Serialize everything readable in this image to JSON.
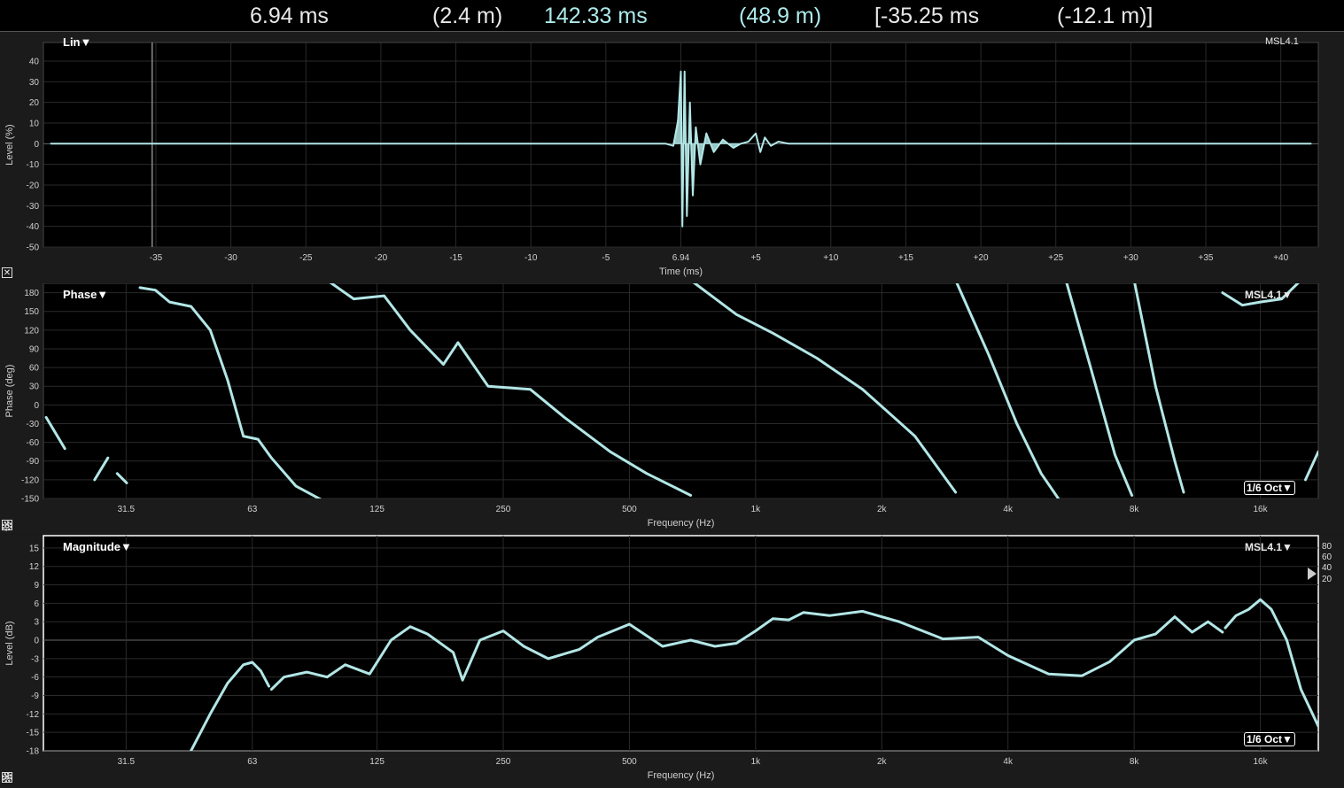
{
  "readout": {
    "delay_time": "6.94 ms",
    "delay_dist": "(2.4 m)",
    "abs_time": "142.33 ms",
    "abs_dist": "(48.9 m)",
    "cursor_time": "[-35.25 ms",
    "cursor_dist": "(-12.1 m)]"
  },
  "colors": {
    "trace": "#b3e6e6",
    "plot_bg": "#000000",
    "grid": "#2a2a2a",
    "accent_text": "#aeeaea",
    "text": "#ffffff"
  },
  "icons": {
    "close": "close-icon",
    "gear": "gear-icon"
  },
  "impulse": {
    "mode_label": "Lin▼",
    "device_label": "MSL4.1",
    "ylabel": "Level (%)",
    "xlabel": "Time (ms)",
    "chart_data": {
      "type": "line",
      "title": "",
      "xlabel": "Time (ms)",
      "ylabel": "Level (%)",
      "x_ticks": [
        "-35",
        "-30",
        "-25",
        "-20",
        "-15",
        "-10",
        "-5",
        "6.94",
        "+5",
        "+10",
        "+15",
        "+20",
        "+25",
        "+30",
        "+35",
        "+40"
      ],
      "x_tick_values": [
        -35,
        -30,
        -25,
        -20,
        -15,
        -10,
        -5,
        0,
        5,
        10,
        15,
        20,
        25,
        30,
        35,
        40
      ],
      "xlim": [
        -42.5,
        42.5
      ],
      "y_ticks": [
        "40",
        "30",
        "20",
        "10",
        "0",
        "-10",
        "-20",
        "-30",
        "-40",
        "-50"
      ],
      "y_tick_values": [
        40,
        30,
        20,
        10,
        0,
        -10,
        -20,
        -30,
        -40,
        -50
      ],
      "ylim": [
        -50,
        49
      ],
      "grid": true,
      "cursor_x": -35.25,
      "series": [
        {
          "values_x": [
            -42,
            -30,
            -10,
            -1,
            -0.5,
            -0.2,
            0,
            0.1,
            0.25,
            0.4,
            0.6,
            0.8,
            1.0,
            1.3,
            1.7,
            2.2,
            2.8,
            3.5,
            4.0,
            4.5,
            5.0,
            5.3,
            5.6,
            6.0,
            6.5,
            7.2,
            8,
            12,
            20,
            30,
            42
          ],
          "values_y": [
            0,
            0,
            0,
            0,
            -1,
            10,
            35,
            -40,
            35,
            -35,
            20,
            -25,
            8,
            -10,
            5,
            -4,
            2,
            -2,
            0,
            1,
            5,
            -4,
            3,
            -1,
            1,
            0,
            0,
            0,
            0,
            0,
            0
          ]
        }
      ]
    }
  },
  "phase": {
    "mode_label": "Phase▼",
    "device_label": "MSL4.1▼",
    "smoothing_label": "1/6 Oct▼",
    "ylabel": "Phase (deg)",
    "xlabel": "Frequency (Hz)",
    "chart_data": {
      "type": "line",
      "title": "",
      "xlabel": "Frequency (Hz)",
      "ylabel": "Phase (deg)",
      "xscale": "log",
      "xlim": [
        20,
        22000
      ],
      "x_ticks": [
        "31.5",
        "63",
        "125",
        "250",
        "500",
        "1k",
        "2k",
        "4k",
        "8k",
        "16k"
      ],
      "x_tick_values": [
        31.5,
        63,
        125,
        250,
        500,
        1000,
        2000,
        4000,
        8000,
        16000
      ],
      "y_ticks": [
        "180",
        "150",
        "120",
        "90",
        "60",
        "30",
        "0",
        "-30",
        "-60",
        "-90",
        "-120",
        "-150"
      ],
      "y_tick_values": [
        180,
        150,
        120,
        90,
        60,
        30,
        0,
        -30,
        -60,
        -90,
        -120,
        -150
      ],
      "ylim": [
        -150,
        195
      ],
      "grid": true,
      "segments": [
        {
          "x": [
            20.3,
            22.5
          ],
          "y": [
            -20,
            -70
          ]
        },
        {
          "x": [
            26.5,
            28.5
          ],
          "y": [
            -120,
            -85
          ]
        },
        {
          "x": [
            30,
            31.6
          ],
          "y": [
            -110,
            -125
          ]
        },
        {
          "x": [
            34,
            37,
            40,
            45,
            50,
            55,
            60,
            65,
            70,
            80,
            92
          ],
          "y": [
            188,
            184,
            165,
            158,
            120,
            40,
            -50,
            -55,
            -85,
            -130,
            -152
          ]
        },
        {
          "x": [
            95,
            110,
            130,
            150,
            180,
            195,
            230,
            290,
            350,
            450,
            550,
            700
          ],
          "y": [
            200,
            170,
            175,
            120,
            65,
            100,
            30,
            25,
            -20,
            -75,
            -110,
            -145
          ]
        },
        {
          "x": [
            700,
            900,
            1100,
            1400,
            1800,
            2400,
            3000
          ],
          "y": [
            200,
            145,
            115,
            75,
            25,
            -50,
            -140
          ]
        },
        {
          "x": [
            3000,
            3600,
            4200,
            4800,
            5300
          ],
          "y": [
            200,
            80,
            -30,
            -110,
            -152
          ]
        },
        {
          "x": [
            5500,
            6300,
            7200,
            7900
          ],
          "y": [
            200,
            60,
            -80,
            -145
          ]
        },
        {
          "x": [
            8000,
            9000,
            10000,
            10500
          ],
          "y": [
            200,
            30,
            -90,
            -140
          ]
        },
        {
          "x": [
            13000,
            14500,
            16000,
            18000,
            20000
          ],
          "y": [
            180,
            160,
            165,
            170,
            200
          ]
        },
        {
          "x": [
            20500,
            22000
          ],
          "y": [
            -120,
            -75
          ]
        }
      ]
    }
  },
  "magnitude": {
    "mode_label": "Magnitude▼",
    "device_label": "MSL4.1▼",
    "smoothing_label": "1/6 Oct▼",
    "ylabel": "Level (dB)",
    "xlabel": "Frequency (Hz)",
    "side_scale": [
      "80",
      "60",
      "40",
      "20"
    ],
    "chart_data": {
      "type": "line",
      "title": "",
      "xlabel": "Frequency (Hz)",
      "ylabel": "Level (dB)",
      "xscale": "log",
      "xlim": [
        20,
        22000
      ],
      "x_ticks": [
        "31.5",
        "63",
        "125",
        "250",
        "500",
        "1k",
        "2k",
        "4k",
        "8k",
        "16k"
      ],
      "x_tick_values": [
        31.5,
        63,
        125,
        250,
        500,
        1000,
        2000,
        4000,
        8000,
        16000
      ],
      "y_ticks": [
        "15",
        "12",
        "9",
        "6",
        "3",
        "0",
        "-3",
        "-6",
        "-9",
        "-12",
        "-15",
        "-18"
      ],
      "y_tick_values": [
        15,
        12,
        9,
        6,
        3,
        0,
        -3,
        -6,
        -9,
        -12,
        -15,
        -18
      ],
      "ylim": [
        -18,
        17
      ],
      "grid": true,
      "segments": [
        {
          "x": [
            45,
            50,
            55,
            60,
            63,
            66,
            69
          ],
          "y": [
            -18,
            -12,
            -7,
            -4,
            -3.6,
            -5,
            -7.5
          ]
        },
        {
          "x": [
            70,
            75,
            85,
            95,
            105,
            120,
            135,
            150,
            165,
            190,
            200,
            220,
            250,
            280,
            320,
            380,
            420,
            500,
            600,
            700,
            800,
            900,
            1000,
            1100,
            1200,
            1300,
            1500,
            1800,
            2200,
            2800,
            3400,
            4000,
            5000,
            6000,
            7000,
            8000,
            9000,
            10000,
            11000,
            12000,
            13000
          ],
          "y": [
            -8,
            -6,
            -5.2,
            -6,
            -4,
            -5.5,
            0,
            2.2,
            1,
            -2,
            -6.5,
            0,
            1.5,
            -1,
            -3,
            -1.5,
            0.5,
            2.6,
            -1,
            0,
            -1,
            -0.5,
            1.5,
            3.5,
            3.3,
            4.5,
            4,
            4.7,
            3,
            0.2,
            0.5,
            -2.5,
            -5.5,
            -5.8,
            -3.5,
            0,
            1,
            3.8,
            1.3,
            3,
            1.3
          ]
        },
        {
          "x": [
            13200,
            14000,
            15000,
            16000,
            17000,
            18500,
            20000,
            22000
          ],
          "y": [
            2,
            4,
            5,
            6.6,
            5,
            0,
            -8,
            -14
          ]
        }
      ]
    }
  }
}
